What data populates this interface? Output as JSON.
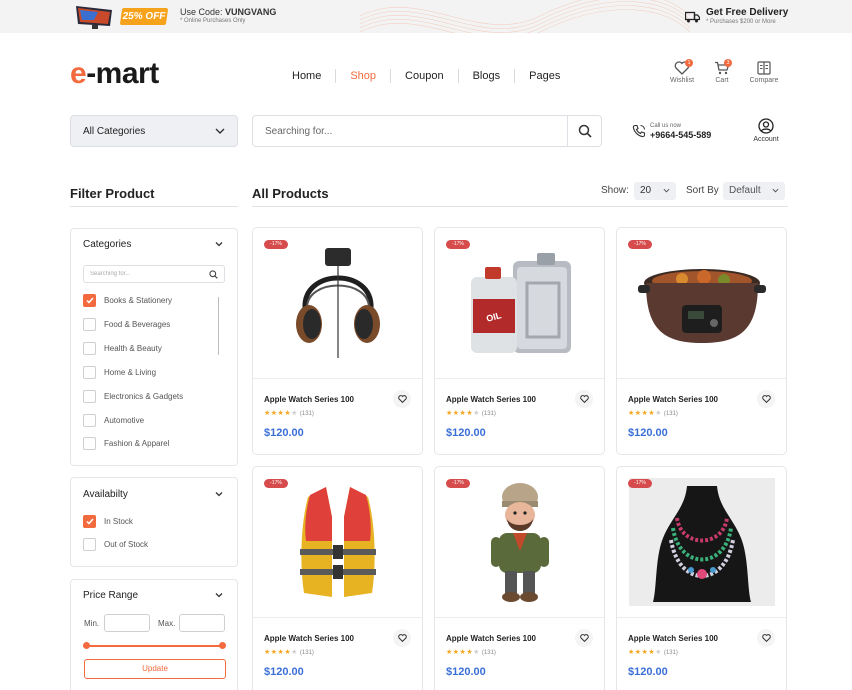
{
  "promo": {
    "badge": "25% OFF",
    "code_prefix": "Use Code: ",
    "code": "VUNGVANG",
    "note": "* Online Purchases Only",
    "delivery_title": "Get Free Delivery",
    "delivery_note": "* Purchases $200 or More"
  },
  "header": {
    "logo_accent": "e",
    "logo_rest": "-mart",
    "nav": [
      "Home",
      "Shop",
      "Coupon",
      "Blogs",
      "Pages"
    ],
    "active_nav": "Shop",
    "icons": [
      {
        "label": "Wishlist",
        "badge": "1",
        "icon": "heart-icon"
      },
      {
        "label": "Cart",
        "badge": "3",
        "icon": "cart-icon"
      },
      {
        "label": "Compare",
        "badge": "",
        "icon": "compare-icon"
      }
    ]
  },
  "search": {
    "category": "All Categories",
    "placeholder": "Searching for...",
    "call_label": "Call us now",
    "call_number": "+9664-545-589",
    "account_label": "Account"
  },
  "filter": {
    "title": "Filter Product",
    "categories": {
      "title": "Categories",
      "search_placeholder": "Searching for...",
      "items": [
        {
          "label": "Books & Stationery",
          "checked": true
        },
        {
          "label": "Food & Beverages",
          "checked": false
        },
        {
          "label": "Health & Beauty",
          "checked": false
        },
        {
          "label": "Home & Living",
          "checked": false
        },
        {
          "label": "Electronics & Gadgets",
          "checked": false
        },
        {
          "label": "Automotive",
          "checked": false
        },
        {
          "label": "Fashion & Apparel",
          "checked": false
        }
      ]
    },
    "availability": {
      "title": "Availabilty",
      "items": [
        {
          "label": "In Stock",
          "checked": true
        },
        {
          "label": "Out of Stock",
          "checked": false
        }
      ]
    },
    "price": {
      "title": "Price Range",
      "min_label": "Min.",
      "max_label": "Max.",
      "button": "Update"
    }
  },
  "products": {
    "title": "All Products",
    "show_label": "Show:",
    "show_value": "20",
    "sort_label": "Sort By",
    "sort_value": "Default",
    "items": [
      {
        "name": "Apple Watch Series 100",
        "price": "$120.00",
        "rating": 4,
        "reviews": "(131)",
        "discount": "-17%",
        "image": "headphones"
      },
      {
        "name": "Apple Watch Series 100",
        "price": "$120.00",
        "rating": 4,
        "reviews": "(131)",
        "discount": "-17%",
        "image": "motor-oil-cans"
      },
      {
        "name": "Apple Watch Series 100",
        "price": "$120.00",
        "rating": 4,
        "reviews": "(131)",
        "discount": "-17%",
        "image": "slow-cooker"
      },
      {
        "name": "Apple Watch Series 100",
        "price": "$120.00",
        "rating": 4,
        "reviews": "(131)",
        "discount": "-17%",
        "image": "life-jacket"
      },
      {
        "name": "Apple Watch Series 100",
        "price": "$120.00",
        "rating": 4,
        "reviews": "(131)",
        "discount": "-17%",
        "image": "figurine"
      },
      {
        "name": "Apple Watch Series 100",
        "price": "$120.00",
        "rating": 4,
        "reviews": "(131)",
        "discount": "-17%",
        "image": "necklace"
      }
    ]
  },
  "colors": {
    "accent": "#f26a3d",
    "price": "#3b6fd8",
    "star": "#f5a623",
    "discount": "#d64b4b"
  }
}
